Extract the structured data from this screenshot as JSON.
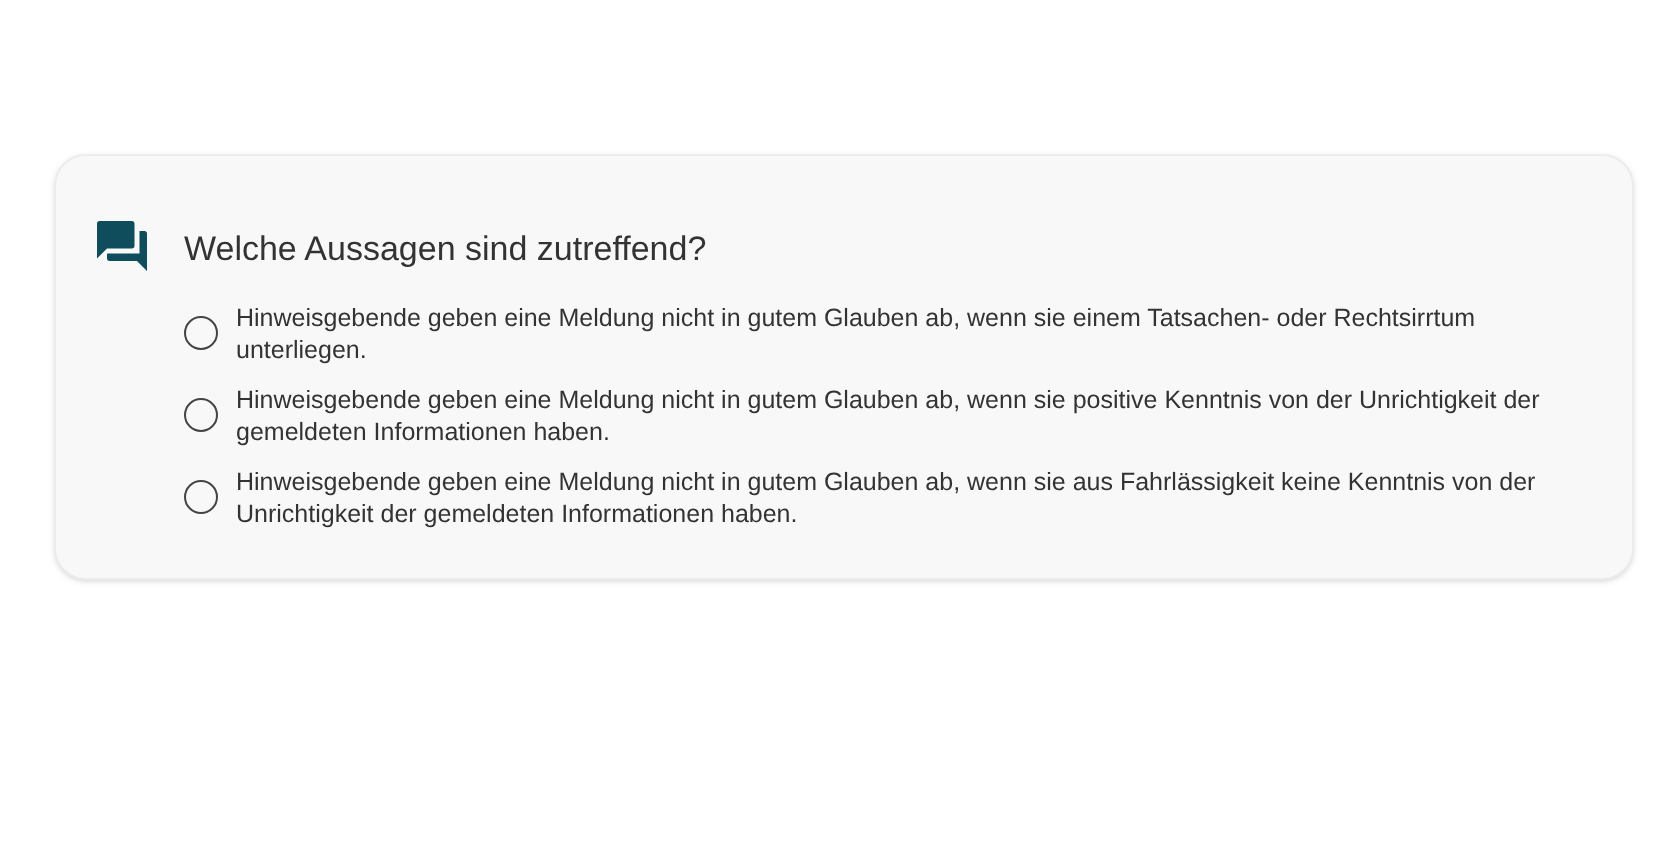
{
  "question": {
    "title": "Welche Aussagen sind zutreffend?",
    "options": [
      {
        "label": "Hinweisgebende geben eine Meldung nicht in gutem Glauben ab, wenn sie einem Tatsachen- oder Rechtsirrtum unterliegen.",
        "selected": false
      },
      {
        "label": "Hinweisgebende geben eine Meldung nicht in gutem Glauben ab, wenn sie positive Kenntnis von der Unrichtigkeit der gemeldeten Informationen haben.",
        "selected": false
      },
      {
        "label": "Hinweisgebende geben eine Meldung nicht in gutem Glauben ab, wenn sie aus Fahrlässigkeit keine Kenntnis von der Unrichtigkeit der gemeldeten Informationen haben.",
        "selected": false
      }
    ]
  }
}
